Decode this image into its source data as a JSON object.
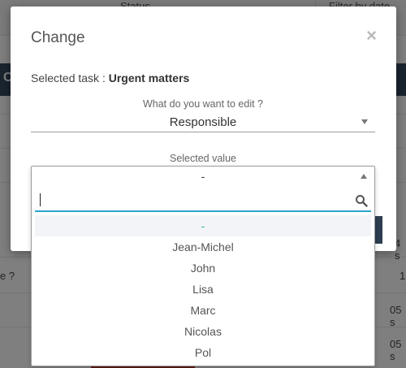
{
  "background": {
    "columns": [
      "Status",
      "Filter by date"
    ],
    "dark_bar_text": "C",
    "cells": [
      "e ?",
      "1",
      "05 s",
      "05 s",
      "4 s"
    ]
  },
  "modal": {
    "title": "Change",
    "close_symbol": "×",
    "selected_task_label": "Selected task : ",
    "selected_task_value": "Urgent matters",
    "edit_label": "What do you want to edit ?",
    "edit_value": "Responsible",
    "selected_value_label": "Selected value",
    "selected_value": "-"
  },
  "dropdown": {
    "search_value": "",
    "search_icon": "search-icon",
    "options": [
      "-",
      "Jean-Michel",
      "John",
      "Lisa",
      "Marc",
      "Nicolas",
      "Pol"
    ],
    "highlighted_index": 0
  },
  "colors": {
    "accent": "#2aa4c9",
    "highlight_text": "#23b39b",
    "dark_bar": "#34495e"
  }
}
